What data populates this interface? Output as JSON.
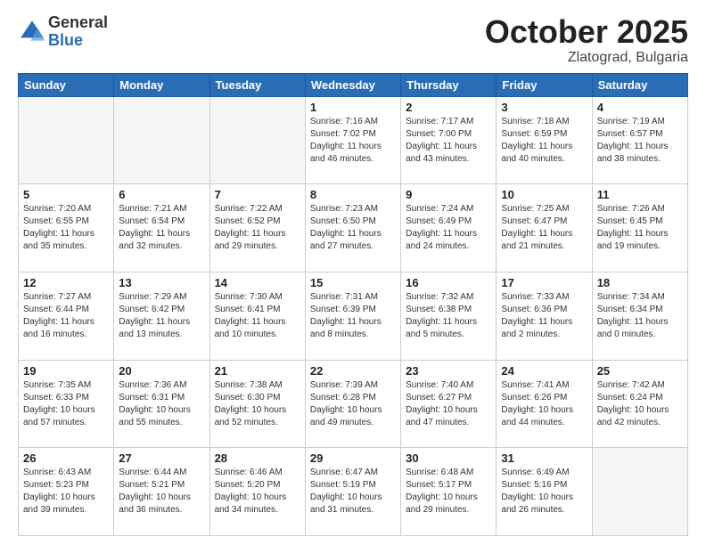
{
  "logo": {
    "general": "General",
    "blue": "Blue"
  },
  "title": "October 2025",
  "location": "Zlatograd, Bulgaria",
  "headers": [
    "Sunday",
    "Monday",
    "Tuesday",
    "Wednesday",
    "Thursday",
    "Friday",
    "Saturday"
  ],
  "weeks": [
    [
      {
        "day": "",
        "info": ""
      },
      {
        "day": "",
        "info": ""
      },
      {
        "day": "",
        "info": ""
      },
      {
        "day": "1",
        "info": "Sunrise: 7:16 AM\nSunset: 7:02 PM\nDaylight: 11 hours\nand 46 minutes."
      },
      {
        "day": "2",
        "info": "Sunrise: 7:17 AM\nSunset: 7:00 PM\nDaylight: 11 hours\nand 43 minutes."
      },
      {
        "day": "3",
        "info": "Sunrise: 7:18 AM\nSunset: 6:59 PM\nDaylight: 11 hours\nand 40 minutes."
      },
      {
        "day": "4",
        "info": "Sunrise: 7:19 AM\nSunset: 6:57 PM\nDaylight: 11 hours\nand 38 minutes."
      }
    ],
    [
      {
        "day": "5",
        "info": "Sunrise: 7:20 AM\nSunset: 6:55 PM\nDaylight: 11 hours\nand 35 minutes."
      },
      {
        "day": "6",
        "info": "Sunrise: 7:21 AM\nSunset: 6:54 PM\nDaylight: 11 hours\nand 32 minutes."
      },
      {
        "day": "7",
        "info": "Sunrise: 7:22 AM\nSunset: 6:52 PM\nDaylight: 11 hours\nand 29 minutes."
      },
      {
        "day": "8",
        "info": "Sunrise: 7:23 AM\nSunset: 6:50 PM\nDaylight: 11 hours\nand 27 minutes."
      },
      {
        "day": "9",
        "info": "Sunrise: 7:24 AM\nSunset: 6:49 PM\nDaylight: 11 hours\nand 24 minutes."
      },
      {
        "day": "10",
        "info": "Sunrise: 7:25 AM\nSunset: 6:47 PM\nDaylight: 11 hours\nand 21 minutes."
      },
      {
        "day": "11",
        "info": "Sunrise: 7:26 AM\nSunset: 6:45 PM\nDaylight: 11 hours\nand 19 minutes."
      }
    ],
    [
      {
        "day": "12",
        "info": "Sunrise: 7:27 AM\nSunset: 6:44 PM\nDaylight: 11 hours\nand 16 minutes."
      },
      {
        "day": "13",
        "info": "Sunrise: 7:29 AM\nSunset: 6:42 PM\nDaylight: 11 hours\nand 13 minutes."
      },
      {
        "day": "14",
        "info": "Sunrise: 7:30 AM\nSunset: 6:41 PM\nDaylight: 11 hours\nand 10 minutes."
      },
      {
        "day": "15",
        "info": "Sunrise: 7:31 AM\nSunset: 6:39 PM\nDaylight: 11 hours\nand 8 minutes."
      },
      {
        "day": "16",
        "info": "Sunrise: 7:32 AM\nSunset: 6:38 PM\nDaylight: 11 hours\nand 5 minutes."
      },
      {
        "day": "17",
        "info": "Sunrise: 7:33 AM\nSunset: 6:36 PM\nDaylight: 11 hours\nand 2 minutes."
      },
      {
        "day": "18",
        "info": "Sunrise: 7:34 AM\nSunset: 6:34 PM\nDaylight: 11 hours\nand 0 minutes."
      }
    ],
    [
      {
        "day": "19",
        "info": "Sunrise: 7:35 AM\nSunset: 6:33 PM\nDaylight: 10 hours\nand 57 minutes."
      },
      {
        "day": "20",
        "info": "Sunrise: 7:36 AM\nSunset: 6:31 PM\nDaylight: 10 hours\nand 55 minutes."
      },
      {
        "day": "21",
        "info": "Sunrise: 7:38 AM\nSunset: 6:30 PM\nDaylight: 10 hours\nand 52 minutes."
      },
      {
        "day": "22",
        "info": "Sunrise: 7:39 AM\nSunset: 6:28 PM\nDaylight: 10 hours\nand 49 minutes."
      },
      {
        "day": "23",
        "info": "Sunrise: 7:40 AM\nSunset: 6:27 PM\nDaylight: 10 hours\nand 47 minutes."
      },
      {
        "day": "24",
        "info": "Sunrise: 7:41 AM\nSunset: 6:26 PM\nDaylight: 10 hours\nand 44 minutes."
      },
      {
        "day": "25",
        "info": "Sunrise: 7:42 AM\nSunset: 6:24 PM\nDaylight: 10 hours\nand 42 minutes."
      }
    ],
    [
      {
        "day": "26",
        "info": "Sunrise: 6:43 AM\nSunset: 5:23 PM\nDaylight: 10 hours\nand 39 minutes."
      },
      {
        "day": "27",
        "info": "Sunrise: 6:44 AM\nSunset: 5:21 PM\nDaylight: 10 hours\nand 36 minutes."
      },
      {
        "day": "28",
        "info": "Sunrise: 6:46 AM\nSunset: 5:20 PM\nDaylight: 10 hours\nand 34 minutes."
      },
      {
        "day": "29",
        "info": "Sunrise: 6:47 AM\nSunset: 5:19 PM\nDaylight: 10 hours\nand 31 minutes."
      },
      {
        "day": "30",
        "info": "Sunrise: 6:48 AM\nSunset: 5:17 PM\nDaylight: 10 hours\nand 29 minutes."
      },
      {
        "day": "31",
        "info": "Sunrise: 6:49 AM\nSunset: 5:16 PM\nDaylight: 10 hours\nand 26 minutes."
      },
      {
        "day": "",
        "info": ""
      }
    ]
  ]
}
